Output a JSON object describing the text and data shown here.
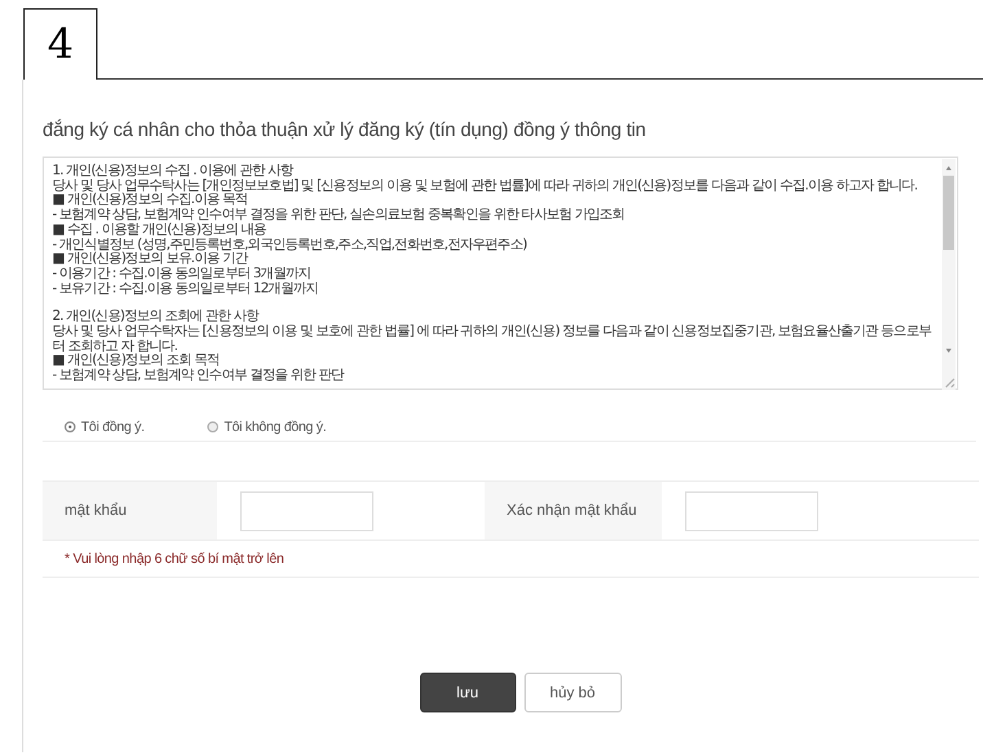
{
  "step": "4",
  "title": "đắng ký cá nhân cho thỏa thuận xử lý đăng ký (tín dụng) đồng ý thông tin",
  "terms": [
    [
      "1. 개인(신용)정보의 수집 . 이용에 관한 사항",
      "당사 및 당사 업무수탁사는 [개인정보보호법] 및 [신용정보의 이용 및 보험에 관한 법률]에 따라 귀하의 개인(신용)정보를 다음과 같이 수집.이용 하고자 합니다.",
      "■ 개인(신용)정보의 수집.이용 목적",
      "- 보험계약 상담, 보험계약 인수여부 결정을 위한 판단, 실손의료보험 중복확인을 위한 타사보험 가입조회",
      "■ 수집 . 이용할 개인(신용)정보의 내용",
      "- 개인식별정보 (성명,주민등록번호,외국인등록번호,주소,직업,전화번호,전자우편주소)",
      "■ 개인(신용)정보의 보유.이용 기간",
      "- 이용기간 : 수집.이용 동의일로부터 3개월까지",
      "- 보유기간 : 수집.이용 동의일로부터 12개월까지"
    ],
    [
      "2. 개인(신용)정보의 조회에 관한 사항",
      "당사 및 당사 업무수탁자는 [신용정보의 이용 및 보호에 관한 법률] 에 따라 귀하의 개인(신용) 정보를 다음과 같이 신용정보집중기관, 보험요율산출기관 등으로부터 조회하고 자 합니다.",
      "■ 개인(신용)정보의 조회 목적",
      "- 보험계약 상담, 보험계약 인수여부 결정을 위한 판단"
    ]
  ],
  "consent": [
    {
      "label": "Tôi đồng ý.",
      "selected": true
    },
    {
      "label": "Tôi không đồng ý.",
      "selected": false
    }
  ],
  "fields": [
    {
      "label": "mật khẩu"
    },
    {
      "label": "Xác nhận mật khẩu"
    }
  ],
  "note": "* Vui lòng nhập 6 chữ số bí mật trở lên",
  "buttons": [
    {
      "label": "lưu",
      "kind": "primary"
    },
    {
      "label": "hủy bỏ",
      "kind": "secondary"
    }
  ]
}
